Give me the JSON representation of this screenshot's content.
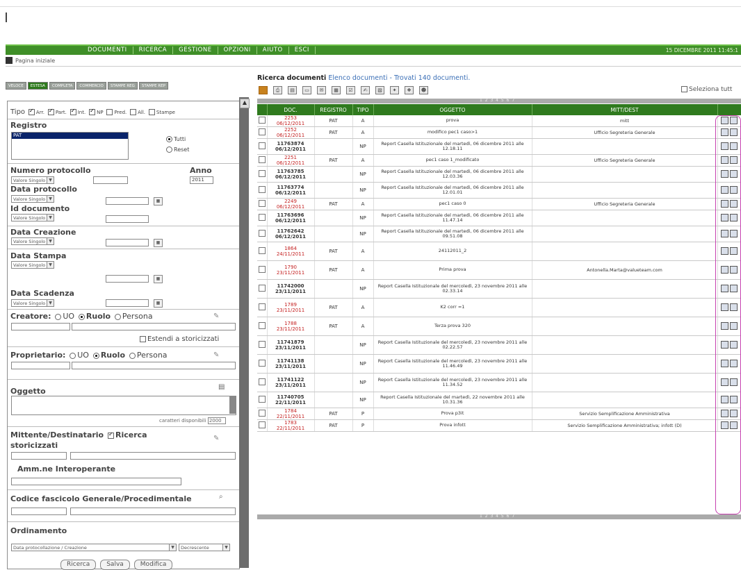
{
  "menu": {
    "items": [
      "DOCUMENTI",
      "RICERCA",
      "GESTIONE",
      "OPZIONI",
      "AIUTO",
      "ESCI"
    ],
    "datetime": "15 DICEMBRE 2011 11:45:1"
  },
  "home": {
    "label": "Pagina iniziale"
  },
  "left_tabs": [
    "VELOCE",
    "ESTESA",
    "COMPLETA",
    "COMMERCIO",
    "STAMPE REG",
    "STAMPE REP"
  ],
  "form": {
    "tipo_label": "Tipo",
    "tipo_opts": [
      {
        "label": "Arr.",
        "checked": true
      },
      {
        "label": "Part.",
        "checked": true
      },
      {
        "label": "Int.",
        "checked": true
      },
      {
        "label": "NP",
        "checked": true
      },
      {
        "label": "Pred.",
        "checked": false
      },
      {
        "label": "All.",
        "checked": false
      },
      {
        "label": "Stampe",
        "checked": false
      }
    ],
    "registro_label": "Registro",
    "registro_selected": "PAT",
    "tutti": "Tutti",
    "reset": "Reset",
    "numero_label": "Numero protocollo",
    "anno_label": "Anno",
    "anno_value": "2011",
    "valore_singolo": "Valore Singolo",
    "data_protocollo": "Data protocollo",
    "id_documento": "Id documento",
    "data_creazione": "Data Creazione",
    "data_stampa": "Data Stampa",
    "data_scadenza": "Data Scadenza",
    "creatore": "Creatore:",
    "uo": "UO",
    "ruolo": "Ruolo",
    "persona": "Persona",
    "estendi": "Estendi a storicizzati",
    "proprietario": "Proprietario:",
    "oggetto": "Oggetto",
    "caratteri": "caratteri disponibili",
    "caratteri_val": "2000",
    "mittente": "Mittente/Destinatario",
    "ricerca_storicizzati": "Ricerca",
    "storicizzati": "storicizzati",
    "amm": "Amm.ne Interoperante",
    "codice": "Codice fascicolo Generale/Procedimentale",
    "ordinamento": "Ordinamento",
    "ord_value": "Data protocollazione / Creazione",
    "ord_dir": "Decrescente",
    "btn_ricerca": "Ricerca",
    "btn_salva": "Salva",
    "btn_modifica": "Modifica"
  },
  "results": {
    "title": "Ricerca documenti",
    "subtitle": "Elenco documenti - Trovati 140 documenti.",
    "select_all": "Seleziona tutt",
    "pager": "1 2 3 4 5 6 7",
    "headers": [
      "DOC.",
      "REGISTRO",
      "TIPO",
      "OGGETTO",
      "MITT/DEST"
    ],
    "rows": [
      {
        "num": "2253",
        "date": "06/12/2011",
        "red": true,
        "reg": "PAT",
        "tipo": "A",
        "ogg": "prova",
        "mitt": "mitt"
      },
      {
        "num": "2252",
        "date": "06/12/2011",
        "red": true,
        "reg": "PAT",
        "tipo": "A",
        "ogg": "modifico pec1 caso>1",
        "mitt": "Ufficio Segreteria Generale"
      },
      {
        "num": "11763874",
        "date": "06/12/2011",
        "red": false,
        "reg": "",
        "tipo": "NP",
        "ogg": "Report Casella Istituzionale del martedì, 06 dicembre 2011 alle 12.18.11",
        "mitt": ""
      },
      {
        "num": "2251",
        "date": "06/12/2011",
        "red": true,
        "reg": "PAT",
        "tipo": "A",
        "ogg": "pec1 caso 1_modificato",
        "mitt": "Ufficio Segreteria Generale"
      },
      {
        "num": "11763785",
        "date": "06/12/2011",
        "red": false,
        "reg": "",
        "tipo": "NP",
        "ogg": "Report Casella Istituzionale del martedì, 06 dicembre 2011 alle 12.03.36",
        "mitt": ""
      },
      {
        "num": "11763774",
        "date": "06/12/2011",
        "red": false,
        "reg": "",
        "tipo": "NP",
        "ogg": "Report Casella Istituzionale del martedì, 06 dicembre 2011 alle 12.01.01",
        "mitt": ""
      },
      {
        "num": "2249",
        "date": "06/12/2011",
        "red": true,
        "reg": "PAT",
        "tipo": "A",
        "ogg": "pec1 caso 0",
        "mitt": "Ufficio Segreteria Generale"
      },
      {
        "num": "11763696",
        "date": "06/12/2011",
        "red": false,
        "reg": "",
        "tipo": "NP",
        "ogg": "Report Casella Istituzionale del martedì, 06 dicembre 2011 alle 11.47.14",
        "mitt": ""
      },
      {
        "num": "11762642",
        "date": "06/12/2011",
        "red": false,
        "reg": "",
        "tipo": "NP",
        "ogg": "Report Casella Istituzionale del martedì, 06 dicembre 2011 alle 09.51.08",
        "mitt": ""
      },
      {
        "num": "1864",
        "date": "24/11/2011",
        "red": true,
        "reg": "PAT",
        "tipo": "A",
        "ogg": "24112011_2",
        "mitt": ""
      },
      {
        "num": "1790",
        "date": "23/11/2011",
        "red": true,
        "reg": "PAT",
        "tipo": "A",
        "ogg": "Prima prova",
        "mitt": "Antonella.Marta@valueteam.com"
      },
      {
        "num": "11742000",
        "date": "23/11/2011",
        "red": false,
        "reg": "",
        "tipo": "NP",
        "ogg": "Report Casella Istituzionale del mercoledì, 23 novembre 2011 alle 02.33.14",
        "mitt": ""
      },
      {
        "num": "1789",
        "date": "23/11/2011",
        "red": true,
        "reg": "PAT",
        "tipo": "A",
        "ogg": "K2 corr =1",
        "mitt": ""
      },
      {
        "num": "1788",
        "date": "23/11/2011",
        "red": true,
        "reg": "PAT",
        "tipo": "A",
        "ogg": "Terza prova 320",
        "mitt": ""
      },
      {
        "num": "11741879",
        "date": "23/11/2011",
        "red": false,
        "reg": "",
        "tipo": "NP",
        "ogg": "Report Casella Istituzionale del mercoledì, 23 novembre 2011 alle 02.22.57",
        "mitt": ""
      },
      {
        "num": "11741138",
        "date": "23/11/2011",
        "red": false,
        "reg": "",
        "tipo": "NP",
        "ogg": "Report Casella Istituzionale del mercoledì, 23 novembre 2011 alle 11.46.49",
        "mitt": ""
      },
      {
        "num": "11741122",
        "date": "23/11/2011",
        "red": false,
        "reg": "",
        "tipo": "NP",
        "ogg": "Report Casella Istituzionale del mercoledì, 23 novembre 2011 alle 11.34.52",
        "mitt": ""
      },
      {
        "num": "11740705",
        "date": "22/11/2011",
        "red": false,
        "reg": "",
        "tipo": "NP",
        "ogg": "Report Casella Istituzionale del martedì, 22 novembre 2011 alle 10.31.36",
        "mitt": ""
      },
      {
        "num": "1784",
        "date": "22/11/2011",
        "red": true,
        "reg": "PAT",
        "tipo": "P",
        "ogg": "Prova p3it",
        "mitt": "Servizio Semplificazione Amministrativa"
      },
      {
        "num": "1783",
        "date": "22/11/2011",
        "red": true,
        "reg": "PAT",
        "tipo": "P",
        "ogg": "Prova infott",
        "mitt": "Servizio Semplificazione Amministrativa; infott (D)"
      }
    ]
  }
}
